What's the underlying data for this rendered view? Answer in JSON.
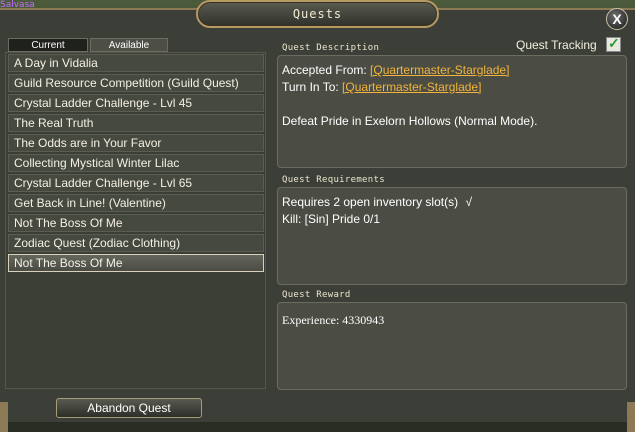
{
  "background": {
    "text": "Salvasa"
  },
  "window": {
    "title": "Quests",
    "close_label": "X"
  },
  "tabs": [
    {
      "label": "Current"
    },
    {
      "label": "Available"
    }
  ],
  "quests": [
    {
      "label": "A Day in Vidalia"
    },
    {
      "label": "Guild Resource Competition (Guild Quest)"
    },
    {
      "label": "Crystal Ladder Challenge - Lvl 45"
    },
    {
      "label": "The Real Truth"
    },
    {
      "label": "The Odds are in Your Favor"
    },
    {
      "label": "Collecting Mystical Winter Lilac"
    },
    {
      "label": "Crystal Ladder Challenge - Lvl 65"
    },
    {
      "label": "Get Back in Line! (Valentine)"
    },
    {
      "label": "Not The Boss Of Me"
    },
    {
      "label": "Zodiac Quest (Zodiac Clothing)"
    },
    {
      "label": "Not The Boss Of Me"
    }
  ],
  "abandon_label": "Abandon Quest",
  "description": {
    "title": "Quest Description",
    "tracking_label": "Quest Tracking",
    "accepted_label": "Accepted From:",
    "accepted_npc": "[Quartermaster-Starglade]",
    "turnin_label": "Turn In To:",
    "turnin_npc": "[Quartermaster-Starglade]",
    "text": "Defeat Pride in Exelorn Hollows (Normal Mode)."
  },
  "requirements": {
    "title": "Quest Requirements",
    "line1": "Requires 2 open inventory slot(s)",
    "check": "√",
    "line2": "Kill: [Sin] Pride 0/1"
  },
  "reward": {
    "title": "Quest Reward",
    "experience": "Experience: 4330943"
  }
}
